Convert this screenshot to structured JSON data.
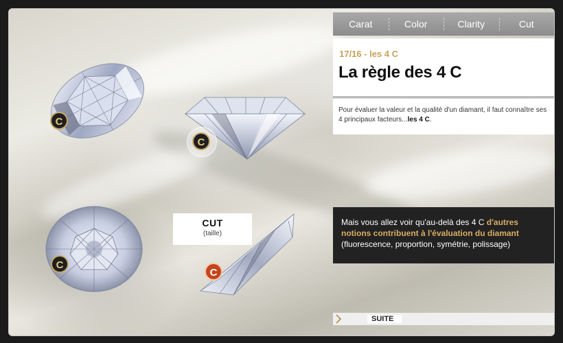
{
  "tabs": [
    {
      "label": "Carat"
    },
    {
      "label": "Color"
    },
    {
      "label": "Clarity"
    },
    {
      "label": "Cut"
    }
  ],
  "header": {
    "subtitle": "17/16 - les 4 C",
    "title": "La règle des 4 C"
  },
  "intro": {
    "text": "Pour évaluer la valeur et la qualité d'un diamant, il faut connaître ses 4 principaux facteurs...",
    "bold": "les 4 C",
    "end": "."
  },
  "callout": {
    "text": "Mais vous allez voir qu'au-delà des 4 C ",
    "highlight": "d'autres notions contribuent à l'évaluation du diamant",
    "note": "(fluorescence, proportion, symétrie, polissage)"
  },
  "cut_label": {
    "title": "CUT",
    "subtitle": "(taille)"
  },
  "badges": [
    {
      "letter": "C",
      "state": "default"
    },
    {
      "letter": "C",
      "state": "hover"
    },
    {
      "letter": "C",
      "state": "default"
    },
    {
      "letter": "C",
      "state": "active"
    }
  ],
  "nav": {
    "next_label": "SUITE",
    "arrow_icon": "chevron-right-icon"
  },
  "colors": {
    "accent_gold": "#c9a05a",
    "active_badge": "#c6431b",
    "dark_panel": "#222222"
  }
}
